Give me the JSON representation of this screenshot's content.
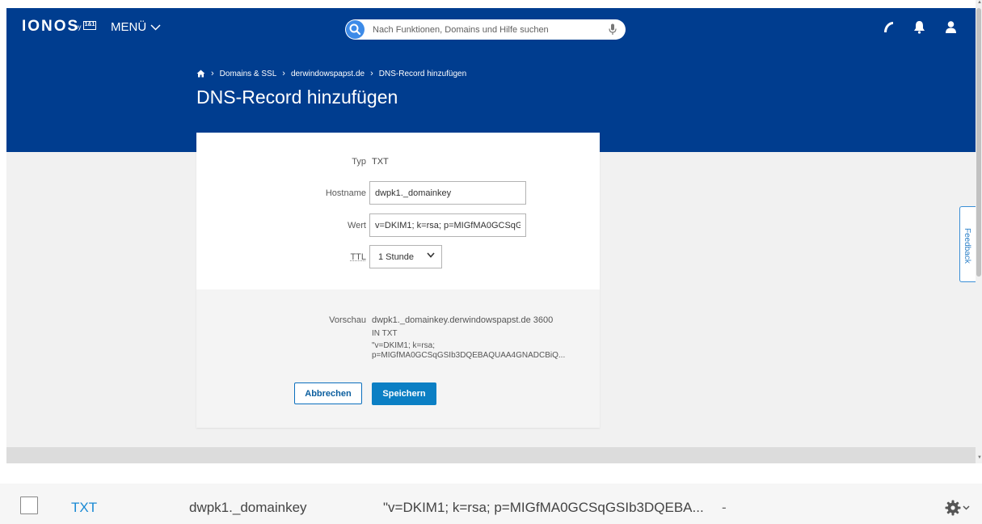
{
  "topbar": {
    "logo_text": "IONOS",
    "logo_by": "by",
    "logo_box": "1&1",
    "menu_label": "MENÜ",
    "search_placeholder": "Nach Funktionen, Domains und Hilfe suchen"
  },
  "breadcrumb": {
    "items": [
      "Domains & SSL",
      "derwindowspapst.de",
      "DNS-Record hinzufügen"
    ]
  },
  "page_title": "DNS-Record hinzufügen",
  "form": {
    "type_label": "Typ",
    "type_value": "TXT",
    "hostname_label": "Hostname",
    "hostname_value": "dwpk1._domainkey",
    "value_label": "Wert",
    "value_value": "v=DKIM1; k=rsa; p=MIGfMA0GCSqGSIb3DQEBAQUAA4GNADCBiQ",
    "ttl_label": "TTL",
    "ttl_selected": "1 Stunde"
  },
  "preview": {
    "label": "Vorschau",
    "line1": "dwpk1._domainkey.derwindowspapst.de  3600",
    "line2": "IN  TXT",
    "line3": "\"v=DKIM1; k=rsa;",
    "line4": "p=MIGfMA0GCSqGSIb3DQEBAQUAA4GNADCBiQ..."
  },
  "buttons": {
    "cancel": "Abbrechen",
    "save": "Speichern"
  },
  "feedback_label": "Feedback",
  "record_row": {
    "type": "TXT",
    "host": "dwpk1._domainkey",
    "value": "\"v=DKIM1; k=rsa; p=MIGfMA0GCSqGSIb3DQEBA...",
    "dash": "-"
  },
  "colors": {
    "brand_blue": "#003d8f",
    "accent_blue": "#0b7fc4",
    "link_blue": "#1a8ad4"
  }
}
